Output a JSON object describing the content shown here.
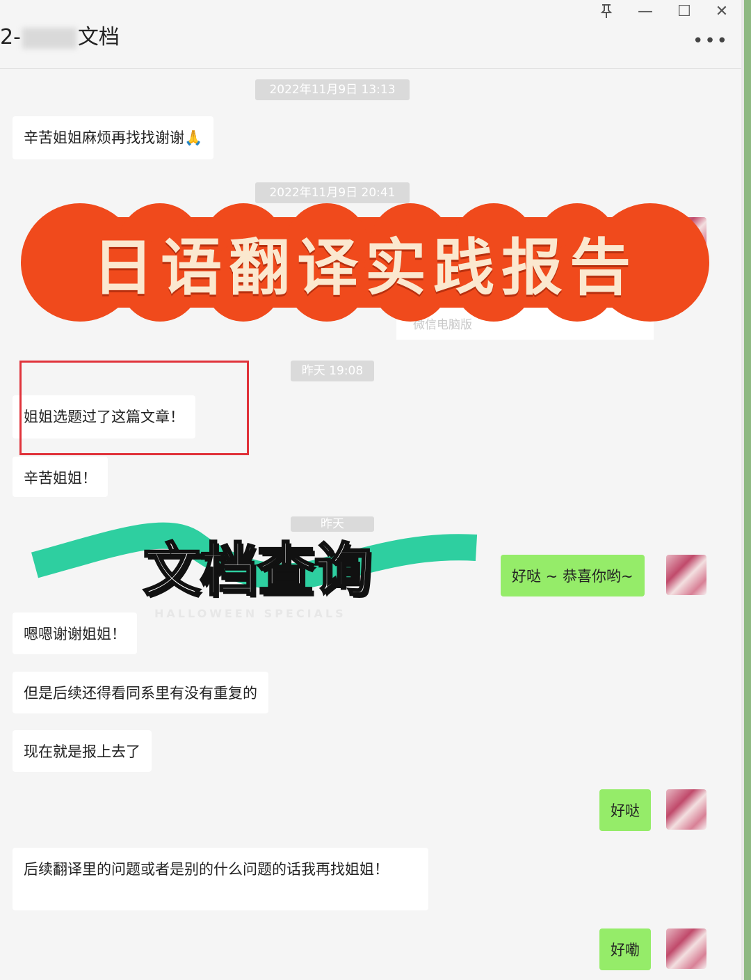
{
  "window": {
    "title_prefix": "2-",
    "title_suffix": "文档",
    "pin_icon": "pin-icon",
    "minimize": "—",
    "maximize": "☐",
    "close": "✕",
    "more": "•••"
  },
  "timestamps": [
    "2022年11月9日 13:13",
    "2022年11月9日 20:41",
    "昨天 19:08",
    "昨天"
  ],
  "behind_text": "微信电脑版",
  "messages": [
    {
      "side": "left",
      "text": "辛苦姐姐麻烦再找找谢谢🙏"
    },
    {
      "side": "left",
      "text": "姐姐选题过了这篇文章！"
    },
    {
      "side": "left",
      "text": "辛苦姐姐！"
    },
    {
      "side": "right",
      "text": "好哒 ~ 恭喜你哟~"
    },
    {
      "side": "left",
      "text": "嗯嗯谢谢姐姐！"
    },
    {
      "side": "left",
      "text": "但是后续还得看同系里有没有重复的"
    },
    {
      "side": "left",
      "text": "现在就是报上去了"
    },
    {
      "side": "right",
      "text": "好哒"
    },
    {
      "side": "left",
      "text": "后续翻译里的问题或者是别的什么问题的话我再找姐姐！"
    },
    {
      "side": "right",
      "text": "好嘞"
    }
  ],
  "overlay": {
    "banner_title": "日语翻译实践报告",
    "banner_color": "#f04a1c",
    "subtitle": "文档查询",
    "stroke_color": "#2ecfa0",
    "watermark": "HALLOWEEN SPECIALS"
  }
}
